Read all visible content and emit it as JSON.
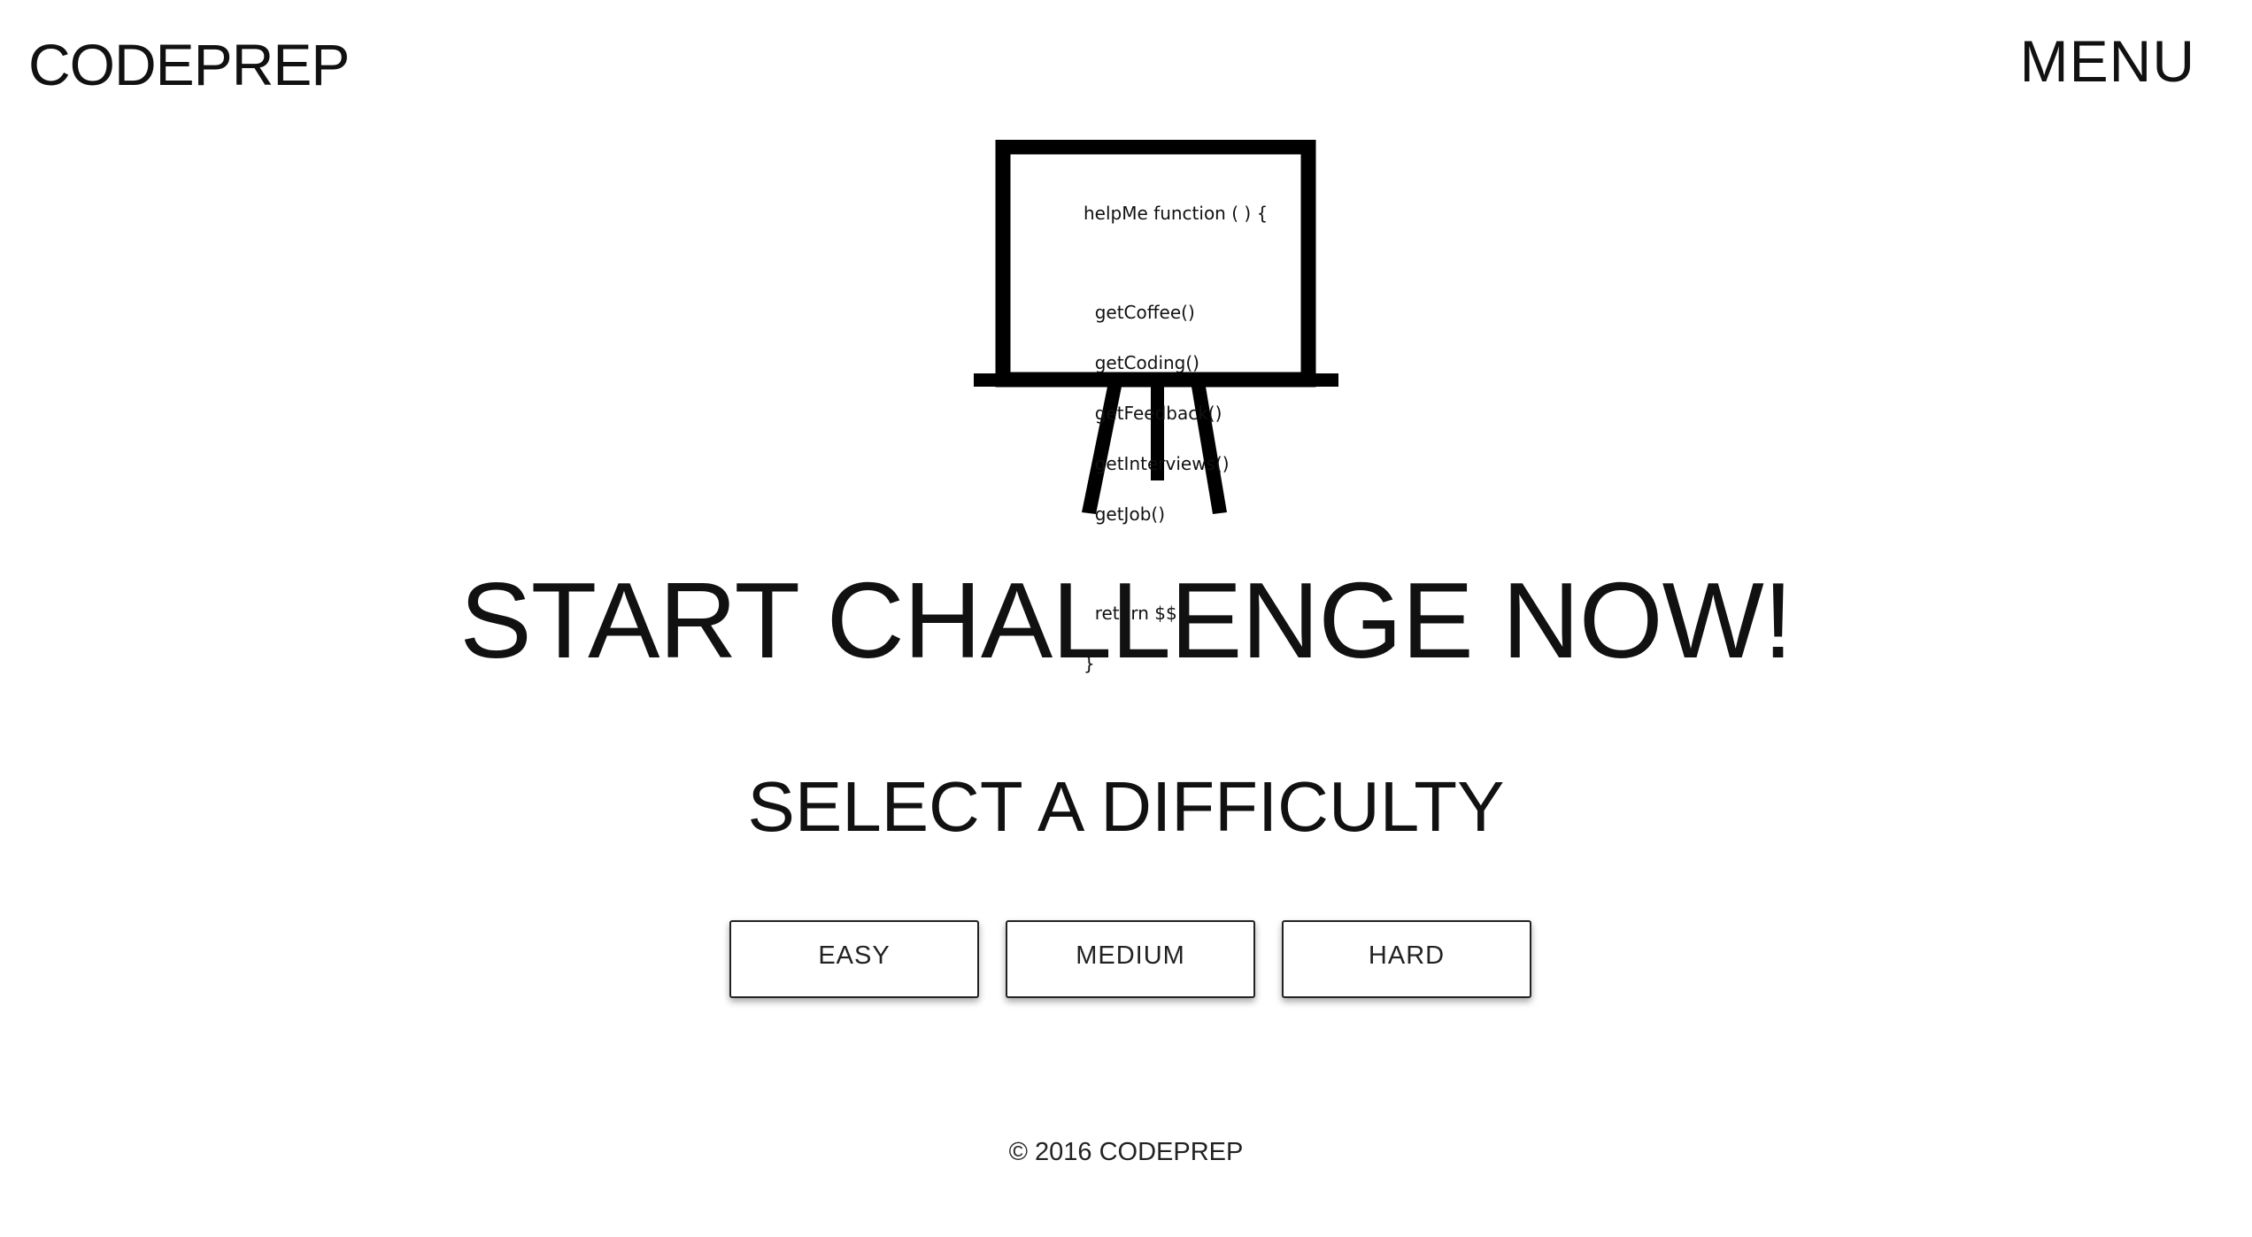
{
  "header": {
    "brand": "CODEPREP",
    "menu_label": "MENU"
  },
  "easel": {
    "code_lines": [
      "helpMe function ( ) {",
      "  getCoffee()",
      "  getCoding()",
      "  getFeedback()",
      "  getInterviews()",
      "  getJob()",
      "  return $$",
      "}"
    ]
  },
  "main": {
    "headline": "START CHALLENGE NOW!",
    "subhead": "SELECT A DIFFICULTY",
    "difficulty_buttons": [
      "EASY",
      "MEDIUM",
      "HARD"
    ]
  },
  "footer": {
    "copyright": "© 2016 CODEPREP"
  }
}
